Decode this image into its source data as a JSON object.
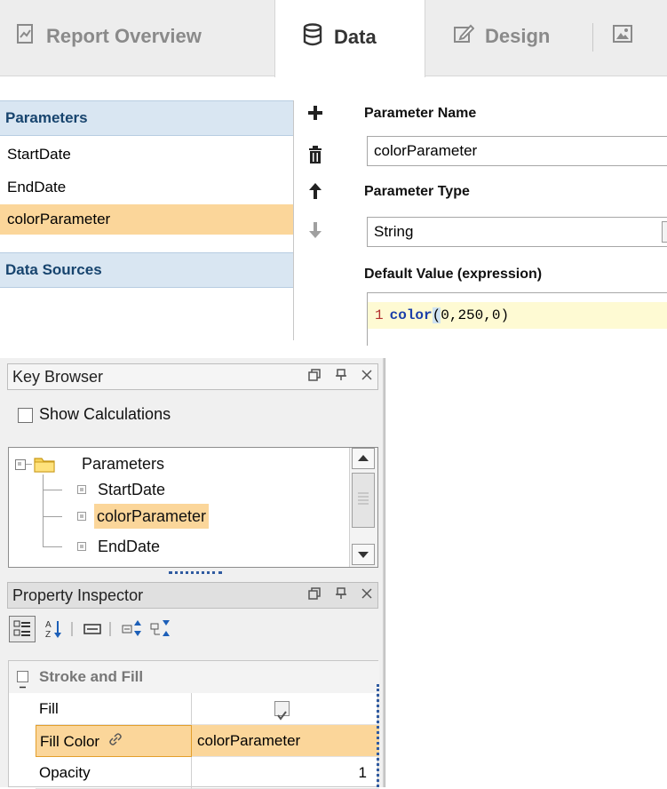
{
  "tabs": [
    {
      "label": "Report Overview",
      "icon": "report-overview-icon",
      "active": false
    },
    {
      "label": "Data",
      "icon": "database-icon",
      "active": true
    },
    {
      "label": "Design",
      "icon": "design-pencil-icon",
      "active": false
    },
    {
      "label": "",
      "icon": "image-preview-icon",
      "active": false
    }
  ],
  "parameters_panel": {
    "parameters_header": "Parameters",
    "parameters": [
      "StartDate",
      "EndDate",
      "colorParameter"
    ],
    "selected_parameter": "colorParameter",
    "data_sources_header": "Data Sources"
  },
  "toolbar": {
    "add_icon": "plus-icon",
    "delete_icon": "trash-icon",
    "move_up_icon": "arrow-up-icon",
    "move_down_icon": "arrow-down-icon"
  },
  "editor": {
    "name_label": "Parameter Name",
    "name_value": "colorParameter",
    "type_label": "Parameter Type",
    "type_value": "String",
    "default_label": "Default Value (expression)",
    "code_line_number": "1",
    "code_func": "color",
    "code_open_paren": "(",
    "code_args": "0,250,0",
    "code_close_paren": ")"
  },
  "key_browser": {
    "title": "Key Browser",
    "show_calculations_label": "Show Calculations",
    "show_calculations_checked": false,
    "root": "Parameters",
    "items": [
      "StartDate",
      "colorParameter",
      "EndDate"
    ],
    "selected_item": "colorParameter"
  },
  "property_inspector": {
    "title": "Property Inspector",
    "category": "Stroke and Fill",
    "rows": [
      {
        "name": "Fill",
        "value": ""
      },
      {
        "name": "Fill Color",
        "value": "colorParameter"
      },
      {
        "name": "Opacity",
        "value": "1"
      }
    ],
    "fill_checked": true
  },
  "colors": {
    "selection": "#fbd69a",
    "section_header": "#d9e6f2",
    "section_header_text": "#17446e",
    "code_keyword": "#1c3fa9",
    "code_line_bg": "#fefad3"
  }
}
